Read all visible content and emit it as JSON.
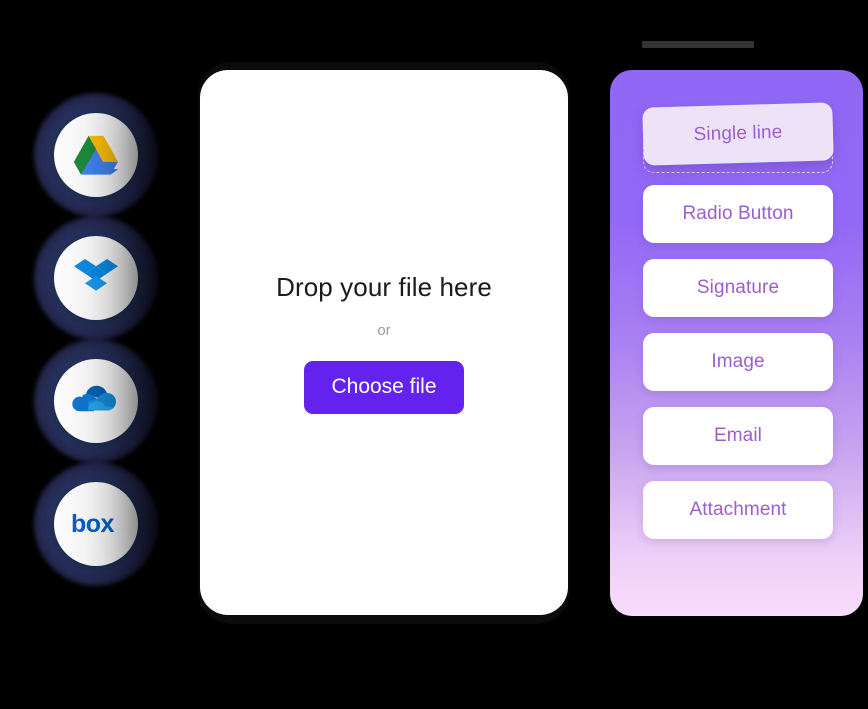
{
  "colors": {
    "background": "#000000",
    "button_purple": "#6322ee",
    "panel_top_purple": "#9168f6",
    "panel_bottom_pink": "#f9ddfb",
    "field_label_purple": "#9d5ec9",
    "dragging_card_bg": "#ece3f7",
    "topbar_gray": "#343434"
  },
  "cloud_rail": {
    "name": "cloud-storage-providers",
    "items": [
      {
        "icon": "google-drive-icon",
        "label": "Google Drive"
      },
      {
        "icon": "dropbox-icon",
        "label": "Dropbox"
      },
      {
        "icon": "onedrive-icon",
        "label": "OneDrive"
      },
      {
        "icon": "box-icon",
        "label": "Box"
      }
    ]
  },
  "drop_card": {
    "title": "Drop your file here",
    "separator": "or",
    "button_label": "Choose file"
  },
  "field_panel": {
    "items": [
      {
        "label": "Single line",
        "state": "dragging"
      },
      {
        "label": "Radio Button",
        "state": "default"
      },
      {
        "label": "Signature",
        "state": "default"
      },
      {
        "label": "Image",
        "state": "default"
      },
      {
        "label": "Email",
        "state": "default"
      },
      {
        "label": "Attachment",
        "state": "default"
      }
    ]
  }
}
